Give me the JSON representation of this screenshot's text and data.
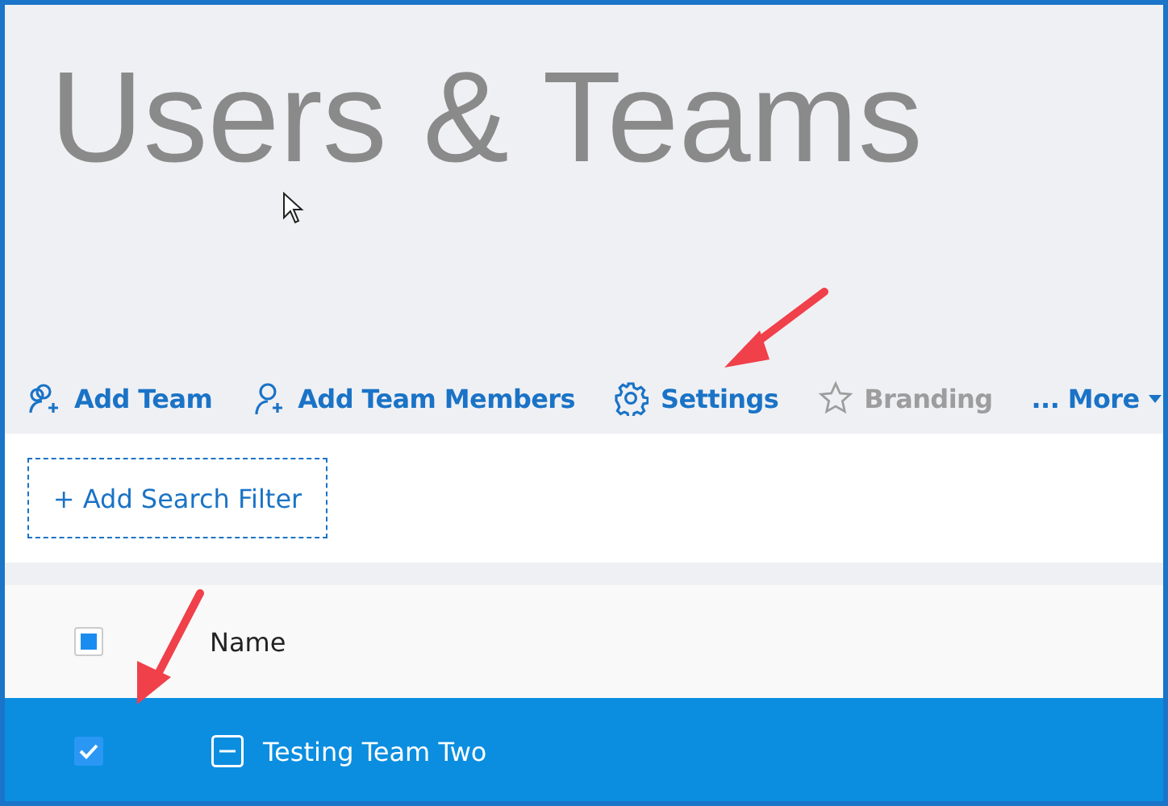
{
  "page": {
    "title": "Users & Teams"
  },
  "toolbar": [
    {
      "label": "Add Team",
      "kind": "team",
      "disabled": false
    },
    {
      "label": "Add Team Members",
      "kind": "member",
      "disabled": false
    },
    {
      "label": "Settings",
      "kind": "settings",
      "disabled": false
    },
    {
      "label": "Branding",
      "kind": "branding",
      "disabled": true
    },
    {
      "label": "... More",
      "kind": "more",
      "disabled": false
    }
  ],
  "filter": {
    "label": "+ Add Search Filter"
  },
  "table": {
    "header": {
      "label": "Name",
      "indeterminate": true
    },
    "rows": [
      {
        "name": "Testing Team Two",
        "selected": true,
        "checked": true,
        "expanded": true
      }
    ]
  }
}
